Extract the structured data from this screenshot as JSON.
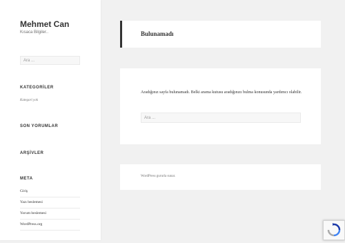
{
  "site": {
    "title": "Mehmet Can",
    "description": "Kısaca Bilgiler.."
  },
  "sidebar": {
    "search_placeholder": "Ara ...",
    "categories": {
      "title": "KATEGORİLER",
      "empty": "Kategori yok"
    },
    "recent_comments": {
      "title": "SON YORUMLAR"
    },
    "archives": {
      "title": "ARŞİVLER"
    },
    "meta": {
      "title": "META",
      "items": [
        "Giriş",
        "Yazı beslemesi",
        "Yorum beslemesi",
        "WordPress.org"
      ]
    }
  },
  "main": {
    "page_title": "Bulunamadı",
    "message": "Aradığınız sayfa bulunamadı. Belki arama kutusu aradığınızı bulma konusunda yardımcı olabilir.",
    "search_placeholder": "Ara ..."
  },
  "footer": {
    "text": "WordPress gururla sunar."
  },
  "icons": {
    "recaptcha": "recaptcha-icon"
  },
  "colors": {
    "accent": "#333333",
    "background": "#f1f1f1"
  }
}
